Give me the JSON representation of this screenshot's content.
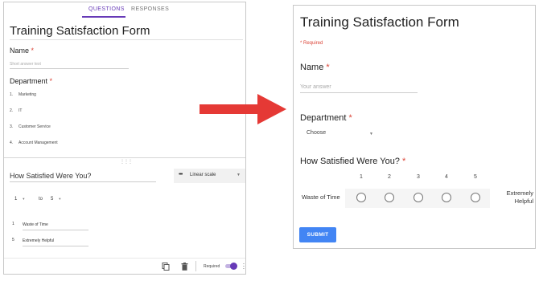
{
  "editor": {
    "tabs": {
      "questions": "QUESTIONS",
      "responses": "RESPONSES"
    },
    "form_title": "Training Satisfaction Form",
    "name_question": {
      "label": "Name",
      "required_mark": "*",
      "placeholder": "Short answer text"
    },
    "department_question": {
      "label": "Department",
      "required_mark": "*",
      "options": [
        {
          "num": "1.",
          "text": "Marketing"
        },
        {
          "num": "2.",
          "text": "IT"
        },
        {
          "num": "3.",
          "text": "Customer Service"
        },
        {
          "num": "4.",
          "text": "Account Management"
        }
      ]
    },
    "scale_question": {
      "title": "How Satisfied Were You?",
      "type_label": "Linear scale",
      "range_from": "1",
      "range_to_word": "to",
      "range_to": "5",
      "low_num": "1",
      "low_label": "Waste of Time",
      "high_num": "5",
      "high_label": "Extremely Helpful"
    },
    "footer": {
      "required_label": "Required",
      "required_on": true
    }
  },
  "preview": {
    "title": "Training Satisfaction Form",
    "required_note": "* Required",
    "name_label": "Name",
    "required_mark": "*",
    "name_placeholder": "Your answer",
    "department_label": "Department",
    "department_select": "Choose",
    "scale_label": "How Satisfied Were You?",
    "scale_numbers": [
      "1",
      "2",
      "3",
      "4",
      "5"
    ],
    "low_label": "Waste of Time",
    "high_label": "Extremely Helpful",
    "submit_label": "SUBMIT"
  },
  "colors": {
    "accent": "#673ab7",
    "required": "#db4437",
    "submit": "#4285f4",
    "arrow": "#e53935"
  }
}
